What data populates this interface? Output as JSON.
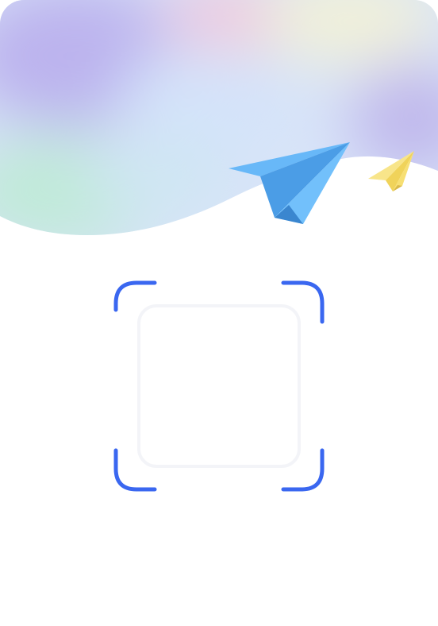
{
  "screen": {
    "theme": {
      "accent": "#3a67f0",
      "scan_box_border": "#f3f4f8",
      "background": "#ffffff"
    },
    "header": {
      "decoration": "pastel-gradient-wave",
      "planes": [
        {
          "icon": "paper-plane-blue-icon",
          "color": "#5aaef0"
        },
        {
          "icon": "paper-plane-yellow-icon",
          "color": "#f6df6a"
        }
      ]
    },
    "scanner": {
      "frame_icon": "scan-frame-corners-icon",
      "frame_color": "#3a67f0",
      "placeholder_icon": "empty-scan-box"
    }
  }
}
